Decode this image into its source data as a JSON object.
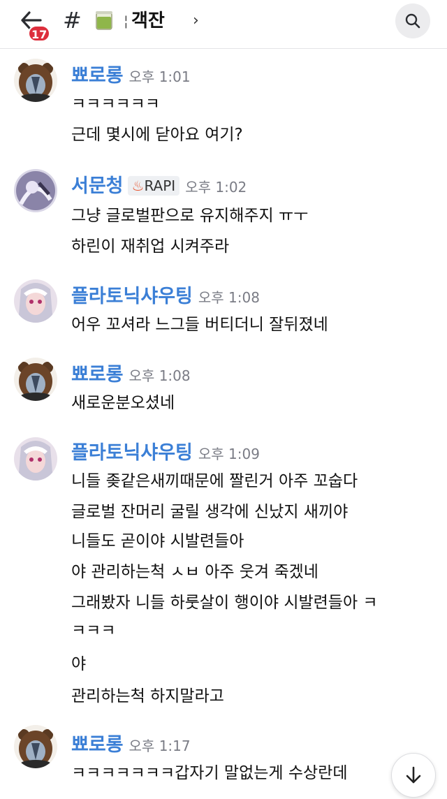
{
  "header": {
    "unread_badge": "17",
    "channel_name": "객잔",
    "chevron": "›",
    "channel_emoji": "tea-cup-icon"
  },
  "messages": [
    {
      "author": "뾰로롱",
      "time": "오후 1:01",
      "avatar": "bear-avatar",
      "lines": [
        "ㅋㅋㅋㅋㅋㅋ",
        "근데 몇시에 닫아요 여기?"
      ]
    },
    {
      "author": "서문청",
      "time": "오후 1:02",
      "role": "RAPI",
      "avatar": "purple-avatar",
      "lines": [
        "그냥 글로벌판으로 유지해주지 ㅠㅜ",
        "하린이 재취업 시켜주라"
      ]
    },
    {
      "author": "플라토닉샤우팅",
      "time": "오후 1:08",
      "avatar": "anime-avatar",
      "lines": [
        "어우 꼬셔라 느그들 버티더니 잘뒤졌네"
      ]
    },
    {
      "author": "뾰로롱",
      "time": "오후 1:08",
      "avatar": "bear-avatar",
      "lines": [
        "새로운분오셨네"
      ]
    },
    {
      "author": "플라토닉샤우팅",
      "time": "오후 1:09",
      "avatar": "anime-avatar",
      "lines": [
        "니들 좆같은새끼때문에 짤린거 아주 꼬숩다",
        "글로벌 잔머리 굴릴 생각에 신났지 새끼야",
        "니들도 곧이야 시발련들아",
        "야 관리하는척 ㅅㅂ 아주 웃겨 죽겠네",
        "그래봤자 니들 하룻살이 행이야 시발련들아 ㅋ",
        "ㅋㅋㅋ",
        "야",
        "관리하는척 하지말라고"
      ]
    },
    {
      "author": "뾰로롱",
      "time": "오후 1:17",
      "avatar": "bear-avatar",
      "lines": [
        "ㅋㅋㅋㅋㅋㅋㅋ갑자기 말없는게 수상란데"
      ]
    }
  ],
  "colors": {
    "author": "#3b7fd6",
    "time": "#7a7c85",
    "badge": "#dd2e3c"
  },
  "scroll_button": "arrow-down-icon"
}
